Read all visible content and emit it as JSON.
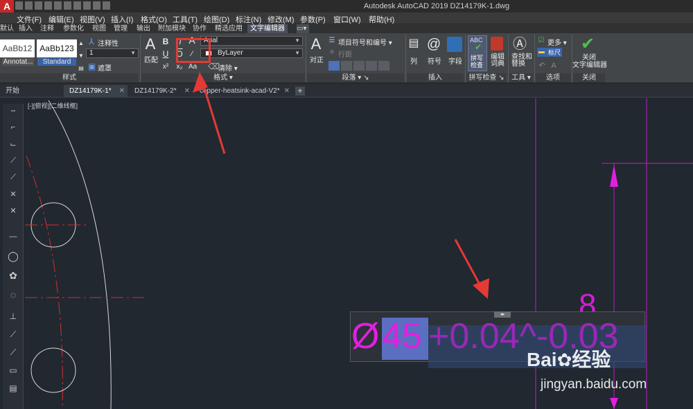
{
  "window": {
    "app_title": "Autodesk AutoCAD 2019    DZ14179K-1.dwg",
    "app_icon": "A"
  },
  "menu": [
    "文件(F)",
    "编辑(E)",
    "视图(V)",
    "插入(I)",
    "格式(O)",
    "工具(T)",
    "绘图(D)",
    "标注(N)",
    "修改(M)",
    "参数(P)",
    "窗口(W)",
    "帮助(H)"
  ],
  "ribbon_tabs": [
    "默认",
    "插入",
    "注释",
    "参数化",
    "视图",
    "管理",
    "输出",
    "附加模块",
    "协作",
    "精选应用",
    "文字编辑器"
  ],
  "ribbon": {
    "style_panel": {
      "style1": "AaBb12",
      "style1_caption": "Annotat...",
      "style2": "AaBb123",
      "style2_caption": "Standard",
      "annotative_label": "注释性",
      "height_value": "1",
      "mask_label": "遮罩",
      "panel_title": "样式"
    },
    "format_panel": {
      "match_label": "匹配",
      "bold": "B",
      "italic": "I",
      "underline": "U",
      "overline": "O",
      "font_value": "Arial",
      "color_value": "ByLayer",
      "clear_label": "清除",
      "panel_title": "格式"
    },
    "paragraph_panel": {
      "justify_label": "对正",
      "bullets_label": "项目符号和编号",
      "line_spacing_label": "行距",
      "panel_title": "段落"
    },
    "insert_panel": {
      "columns_label": "列",
      "symbol_label": "符号",
      "field_label": "字段",
      "panel_title": "插入"
    },
    "spell_panel": {
      "spell_check_label": "拼写\n检查",
      "edit_dict_label": "编辑\n词典",
      "abc": "ABC",
      "panel_title": "拼写检查"
    },
    "tools_panel": {
      "find_replace_label": "查找和\n替换",
      "panel_title": "工具"
    },
    "options_panel": {
      "more_label": "更多",
      "ruler_label": "标尺",
      "panel_title": "选项"
    },
    "close_panel": {
      "close_label": "关闭\n文字编辑器",
      "panel_title": "关闭"
    }
  },
  "file_tabs": [
    {
      "label": "开始",
      "active": false,
      "closable": false
    },
    {
      "label": "DZ14179K-1*",
      "active": true,
      "closable": true
    },
    {
      "label": "DZ14179K-2*",
      "active": false,
      "closable": true
    },
    {
      "label": "copper-heatsink-acad-V2*",
      "active": false,
      "closable": true
    }
  ],
  "viewport_label": "[-][俯视][二维线框]",
  "mtext": {
    "diameter": "Ø",
    "value_selected": "45",
    "tolerance": "+0.04^-0.03",
    "dim_digit": "8"
  },
  "colors": {
    "magenta": "#d000d0",
    "ribbon_bg": "#434649",
    "canvas_bg": "#212830",
    "annotation_red": "#e53935",
    "selection": "#5b6fc0"
  },
  "watermark": {
    "brand": "Bai",
    "brand2": "经验",
    "url": "jingyan.baidu.com"
  }
}
